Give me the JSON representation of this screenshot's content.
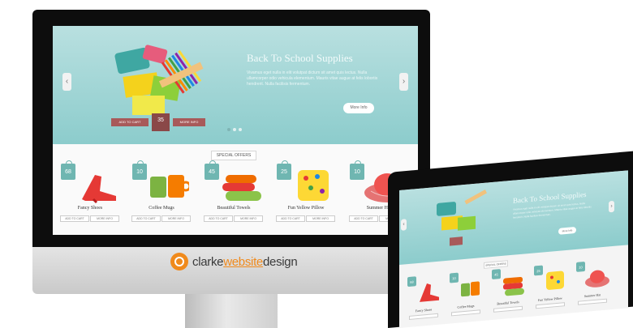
{
  "brand": {
    "logo_prefix": "clarke",
    "logo_mid": "website",
    "logo_suffix": "design"
  },
  "hero": {
    "title": "Back To School Supplies",
    "body": "Vivamus eget nulla in elit volutpat dictum sit amet quis lectus. Nulla ullamcorper odio vehicula elementum. Mauris vitae augue at felis lobortis hendrerit. Nulla facilisis fermentum.",
    "more_button": "More Info",
    "add_to_cart": "ADD TO CART",
    "more_info": "MORE INFO",
    "price": "35",
    "prev_arrow": "‹",
    "next_arrow": "›"
  },
  "special_offers": {
    "label": "SPECIAL OFFERS",
    "add_to_cart": "ADD TO CART",
    "more_info": "MORE INFO",
    "products": [
      {
        "name": "Fancy Shoes",
        "price": "68"
      },
      {
        "name": "Coffee Mugs",
        "price": "10"
      },
      {
        "name": "Beautiful Towels",
        "price": "45"
      },
      {
        "name": "Fun Yellow Pillow",
        "price": "25"
      },
      {
        "name": "Summer Hat",
        "price": "10"
      }
    ]
  },
  "laptop": {
    "hero_title": "Back To School Supplies",
    "special_label": "SPECIAL OFFERS",
    "products": [
      {
        "name": "Fancy Shoes",
        "price": "68"
      },
      {
        "name": "Coffee Mugs",
        "price": "10"
      },
      {
        "name": "Beautiful Towels",
        "price": "45"
      },
      {
        "name": "Fun Yellow Pillow",
        "price": "25"
      },
      {
        "name": "Summer Hat",
        "price": "10"
      }
    ]
  },
  "colors": {
    "hero": "#8ccccc",
    "tag": "#6fb6b1",
    "accent": "#f08a1c",
    "ribbon": "#a85a5a"
  }
}
